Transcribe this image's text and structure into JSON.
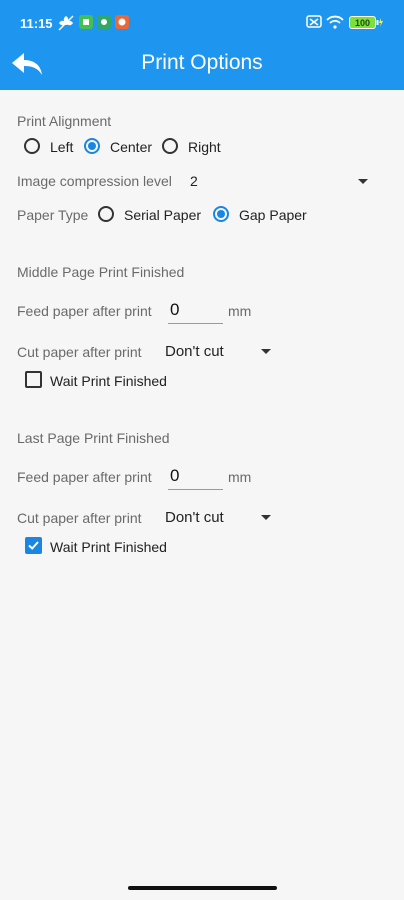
{
  "status": {
    "time": "11:15",
    "battery": "100"
  },
  "header": {
    "title": "Print Options"
  },
  "alignment": {
    "label": "Print Alignment",
    "options": [
      "Left",
      "Center",
      "Right"
    ],
    "selected": "Center"
  },
  "compression": {
    "label": "Image compression level",
    "value": "2"
  },
  "paper_type": {
    "label": "Paper Type",
    "options": [
      "Serial Paper",
      "Gap Paper"
    ],
    "selected": "Gap Paper"
  },
  "middle": {
    "heading": "Middle Page Print Finished",
    "feed_label": "Feed paper after print",
    "feed_value": "0",
    "feed_unit": "mm",
    "cut_label": "Cut paper after print",
    "cut_value": "Don't cut",
    "wait_label": "Wait Print Finished",
    "wait_checked": false
  },
  "last": {
    "heading": "Last Page Print Finished",
    "feed_label": "Feed paper after print",
    "feed_value": "0",
    "feed_unit": "mm",
    "cut_label": "Cut paper after print",
    "cut_value": "Don't cut",
    "wait_label": "Wait Print Finished",
    "wait_checked": true
  },
  "colors": {
    "primary": "#1e96f0",
    "accent": "#1a86e4",
    "battery": "#7be03a",
    "background": "#f6f6f6"
  },
  "icons": [
    "back-arrow-icon",
    "wifi-icon",
    "battery-icon",
    "check-icon",
    "dropdown-caret-icon"
  ]
}
